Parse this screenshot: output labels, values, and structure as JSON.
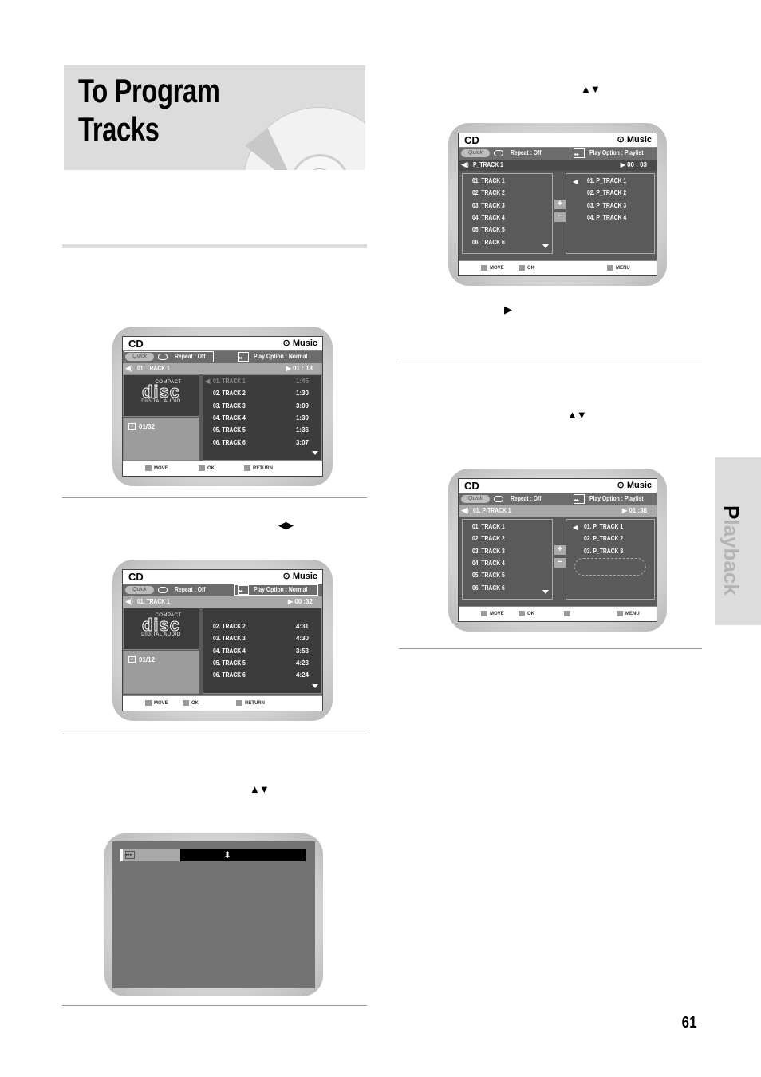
{
  "page": {
    "title": "To Program Tracks",
    "page_number": "61",
    "side_tab": {
      "first_letter": "P",
      "rest": "layback"
    }
  },
  "arrow_glyphs": {
    "up_down": "▲▼",
    "left_right": "◀▶",
    "play": "▶"
  },
  "screens": {
    "s1": {
      "header": {
        "left": "CD",
        "right": "⊙ Music"
      },
      "quick": "Quick",
      "repeat": "Repeat : Off",
      "play_option": "Play Option : Normal",
      "now_playing": {
        "track": "01. TRACK 1",
        "time": "▶ 01 : 18"
      },
      "cd_logo": {
        "top": "COMPACT",
        "mid": "disc",
        "bottom": "DIGITAL AUDIO"
      },
      "counter": "01/32",
      "tracks": [
        {
          "name": "01. TRACK 1",
          "time": "1:45",
          "dim": true
        },
        {
          "name": "02. TRACK 2",
          "time": "1:30"
        },
        {
          "name": "03. TRACK 3",
          "time": "3:09"
        },
        {
          "name": "04. TRACK 4",
          "time": "1:30"
        },
        {
          "name": "05. TRACK 5",
          "time": "1:36"
        },
        {
          "name": "06. TRACK 6",
          "time": "3:07"
        }
      ],
      "footer": [
        "MOVE",
        "OK",
        "RETURN"
      ]
    },
    "s2": {
      "header": {
        "left": "CD",
        "right": "⊙ Music"
      },
      "quick": "Quick",
      "repeat": "Repeat : Off",
      "play_option": "Play Option : Normal",
      "now_playing": {
        "track": "01. TRACK 1",
        "time": "▶ 00 :32"
      },
      "cd_logo": {
        "top": "COMPACT",
        "mid": "disc",
        "bottom": "DIGITAL AUDIO"
      },
      "counter": "01/12",
      "tracks": [
        {
          "name": "02. TRACK 2",
          "time": "4:31"
        },
        {
          "name": "03. TRACK 3",
          "time": "4:30"
        },
        {
          "name": "04. TRACK 4",
          "time": "3:53"
        },
        {
          "name": "05. TRACK 5",
          "time": "4:23"
        },
        {
          "name": "06. TRACK 6",
          "time": "4:24"
        }
      ],
      "footer": [
        "MOVE",
        "OK",
        "RETURN"
      ]
    },
    "s4": {
      "header": {
        "left": "CD",
        "right": "⊙ Music"
      },
      "quick": "Quick",
      "repeat": "Repeat : Off",
      "play_option": "Play Option : Playlist",
      "now_playing": {
        "track": "P_TRACK 1",
        "time": "▶ 00 : 03"
      },
      "left_tracks": [
        "01. TRACK 1",
        "02. TRACK 2",
        "03. TRACK 3",
        "04. TRACK 4",
        "05. TRACK 5",
        "06. TRACK 6"
      ],
      "right_tracks": [
        "01. P_TRACK 1",
        "02. P_TRACK 2",
        "03. P_TRACK 3",
        "04. P_TRACK 4"
      ],
      "footer": [
        "MOVE",
        "OK",
        "MENU"
      ]
    },
    "s5": {
      "header": {
        "left": "CD",
        "right": "⊙ Music"
      },
      "quick": "Quick",
      "repeat": "Repeat : Off",
      "play_option": "Play Option : Playlist",
      "now_playing": {
        "track": "01. P-TRACK 1",
        "time": "▶ 01 :38"
      },
      "left_tracks": [
        "01. TRACK 1",
        "02. TRACK 2",
        "03. TRACK 3",
        "04. TRACK 4",
        "05. TRACK 5",
        "06. TRACK 6"
      ],
      "right_tracks": [
        "01. P_TRACK 1",
        "02. P_TRACK 2",
        "03. P_TRACK 3"
      ],
      "footer": [
        "MOVE",
        "OK",
        "MENU"
      ]
    },
    "s3": {
      "selector_arrows": "⬍"
    }
  }
}
